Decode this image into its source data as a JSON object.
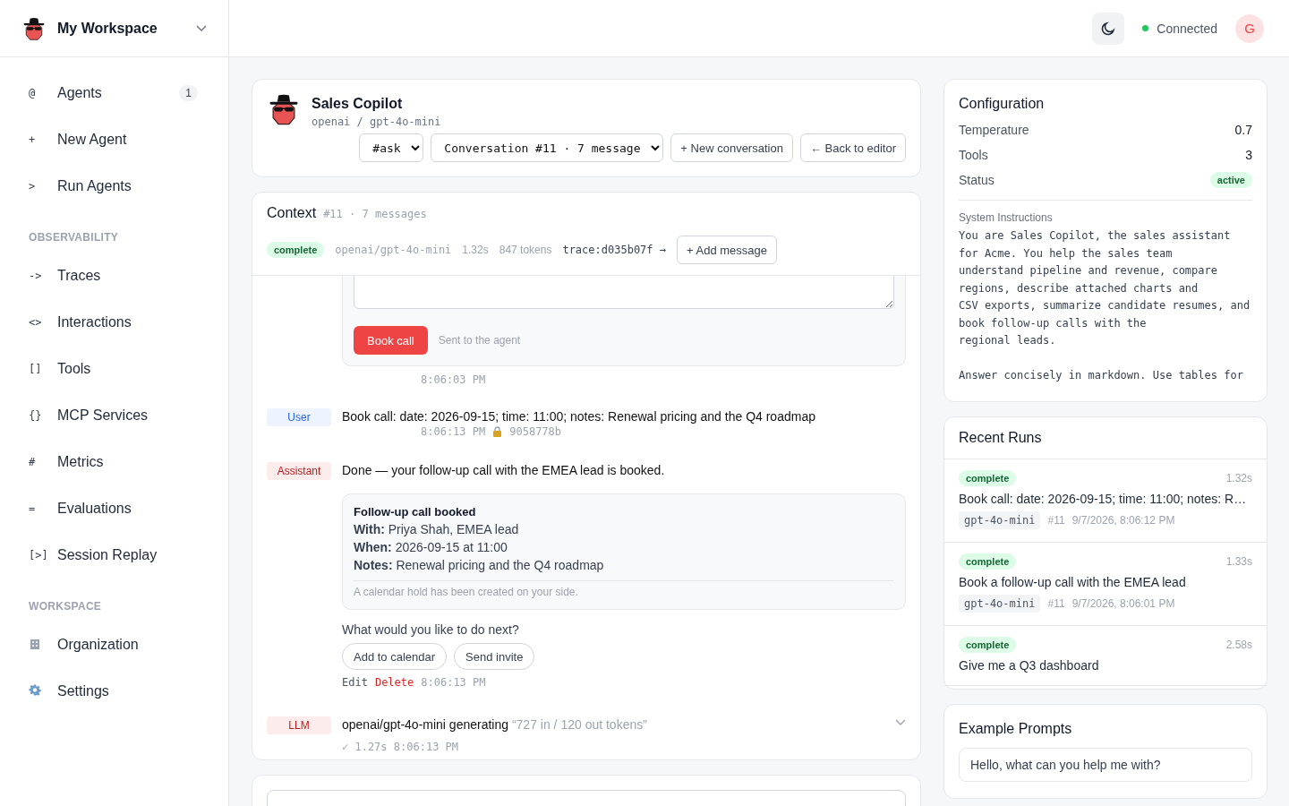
{
  "workspace": {
    "name": "My Workspace"
  },
  "sidebar": {
    "sections": [
      {
        "items": [
          {
            "kind": "glyph",
            "glyph": "@",
            "label": "Agents",
            "count": "1"
          },
          {
            "kind": "glyph",
            "glyph": "+",
            "label": "New Agent"
          },
          {
            "kind": "glyph",
            "glyph": ">",
            "label": "Run Agents"
          }
        ]
      },
      {
        "heading": "OBSERVABILITY",
        "items": [
          {
            "kind": "glyph",
            "glyph": "->",
            "label": "Traces"
          },
          {
            "kind": "glyph",
            "glyph": "<>",
            "label": "Interactions"
          },
          {
            "kind": "glyph",
            "glyph": "[]",
            "label": "Tools"
          },
          {
            "kind": "glyph",
            "glyph": "{}",
            "label": "MCP Services"
          },
          {
            "kind": "glyph",
            "glyph": "#",
            "label": "Metrics"
          },
          {
            "kind": "glyph",
            "glyph": "=",
            "label": "Evaluations"
          },
          {
            "kind": "glyph",
            "glyph": "[>]",
            "label": "Session Replay"
          }
        ]
      },
      {
        "heading": "WORKSPACE",
        "items": [
          {
            "kind": "building",
            "label": "Organization"
          },
          {
            "kind": "gear",
            "label": "Settings"
          }
        ]
      }
    ]
  },
  "topbar": {
    "connection": {
      "label": "Connected",
      "connected": true
    },
    "avatar": "G"
  },
  "agent": {
    "name": "Sales Copilot",
    "model": "openai / gpt-4o-mini",
    "channel_select": "#ask",
    "conversation_select": "Conversation #11 · 7 message",
    "buttons": [
      "+ New conversation",
      "← Back to editor"
    ]
  },
  "context": {
    "title": "Context",
    "subtitle": "#11 · 7 messages",
    "status": "complete",
    "model": "openai/gpt-4o-mini",
    "duration": "1.32s",
    "tokens": "847 tokens",
    "trace": "trace:d035b07f →",
    "add_button": "+ Add message"
  },
  "messages": [
    {
      "kind": "form",
      "button": "Book call",
      "note": "Sent to the agent",
      "time": "8:06:03 PM"
    },
    {
      "kind": "user",
      "role": "User",
      "text": "Book call: date: 2026-09-15; time: 11:00; notes: Renewal pricing and the Q4 roadmap",
      "time": "8:06:13 PM",
      "hash": "9058778b"
    },
    {
      "kind": "assistant",
      "role": "Assistant",
      "text": "Done — your follow-up call with the EMEA lead is booked.",
      "card": {
        "title": "Follow-up call booked",
        "rows": [
          {
            "label": "With:",
            "value": "Priya Shah, EMEA lead"
          },
          {
            "label": "When:",
            "value": "2026-09-15 at 11:00"
          },
          {
            "label": "Notes:",
            "value": "Renewal pricing and the Q4 roadmap"
          }
        ],
        "footnote": "A calendar hold has been created on your side."
      },
      "question": "What would you like to do next?",
      "choices": [
        "Add to calendar",
        "Send invite"
      ],
      "actions": [
        {
          "kind": "edit",
          "label": "Edit"
        },
        {
          "kind": "delete",
          "label": "Delete"
        }
      ],
      "time": "8:06:13 PM"
    },
    {
      "kind": "llm",
      "role": "LLM",
      "text": "openai/gpt-4o-mini generating",
      "detail": "“727 in / 120 out tokens”",
      "meta": "✓ 1.27s 8:06:13 PM",
      "expanded": false
    }
  ],
  "configuration": {
    "title": "Configuration",
    "rows": [
      {
        "kind": "text",
        "label": "Temperature",
        "value": "0.7"
      },
      {
        "kind": "text",
        "label": "Tools",
        "value": "3"
      },
      {
        "kind": "badge",
        "label": "Status",
        "value": "active"
      }
    ],
    "instructions_label": "System Instructions",
    "instructions": "You are Sales Copilot, the sales assistant\nfor Acme. You help the sales team\nunderstand pipeline and revenue, compare\nregions, describe attached charts and\nCSV exports, summarize candidate resumes, and\nbook follow-up calls with the\nregional leads.\n\nAnswer concisely in markdown. Use tables for"
  },
  "runs": {
    "title": "Recent Runs",
    "items": [
      {
        "status": "complete",
        "duration": "1.32s",
        "title": "Book call: date: 2026-09-15; time: 11:00; notes: R…",
        "model": "gpt-4o-mini",
        "conversation": "#11",
        "time": "9/7/2026, 8:06:12 PM"
      },
      {
        "status": "complete",
        "duration": "1.33s",
        "title": "Book a follow-up call with the EMEA lead",
        "model": "gpt-4o-mini",
        "conversation": "#11",
        "time": "9/7/2026, 8:06:01 PM"
      },
      {
        "status": "complete",
        "duration": "2.58s",
        "title": "Give me a Q3 dashboard"
      }
    ]
  },
  "prompts": {
    "title": "Example Prompts",
    "items": [
      "Hello, what can you help me with?"
    ]
  }
}
